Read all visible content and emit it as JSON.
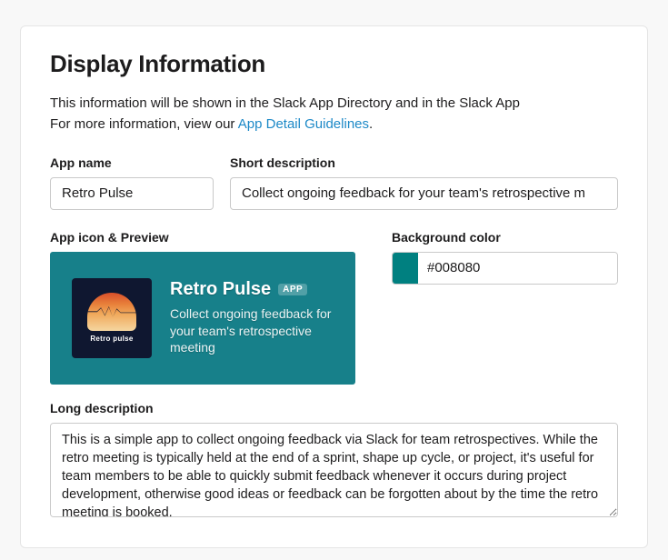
{
  "heading": "Display Information",
  "intro": {
    "line1": "This information will be shown in the Slack App Directory and in the Slack App",
    "line2_prefix": "For more information, view our ",
    "link_text": "App Detail Guidelines",
    "line2_suffix": "."
  },
  "fields": {
    "app_name": {
      "label": "App name",
      "value": "Retro Pulse"
    },
    "short_desc": {
      "label": "Short description",
      "value": "Collect ongoing feedback for your team's retrospective m"
    },
    "icon_preview": {
      "label": "App icon & Preview"
    },
    "bg_color": {
      "label": "Background color",
      "value": "#008080"
    },
    "long_desc": {
      "label": "Long description",
      "value": "This is a simple app to collect ongoing feedback via Slack for team retrospectives. While the retro meeting is typically held at the end of a sprint, shape up cycle, or project, it's useful for team members to be able to quickly submit feedback whenever it occurs during project development, otherwise good ideas or feedback can be forgotten about by the time the retro meeting is booked."
    }
  },
  "preview": {
    "name": "Retro Pulse",
    "badge": "APP",
    "desc": "Collect ongoing feedback for your team's retrospective meeting",
    "icon_label": "Retro pulse"
  },
  "colors": {
    "accent": "#008080",
    "preview_bg": "#17808a"
  }
}
